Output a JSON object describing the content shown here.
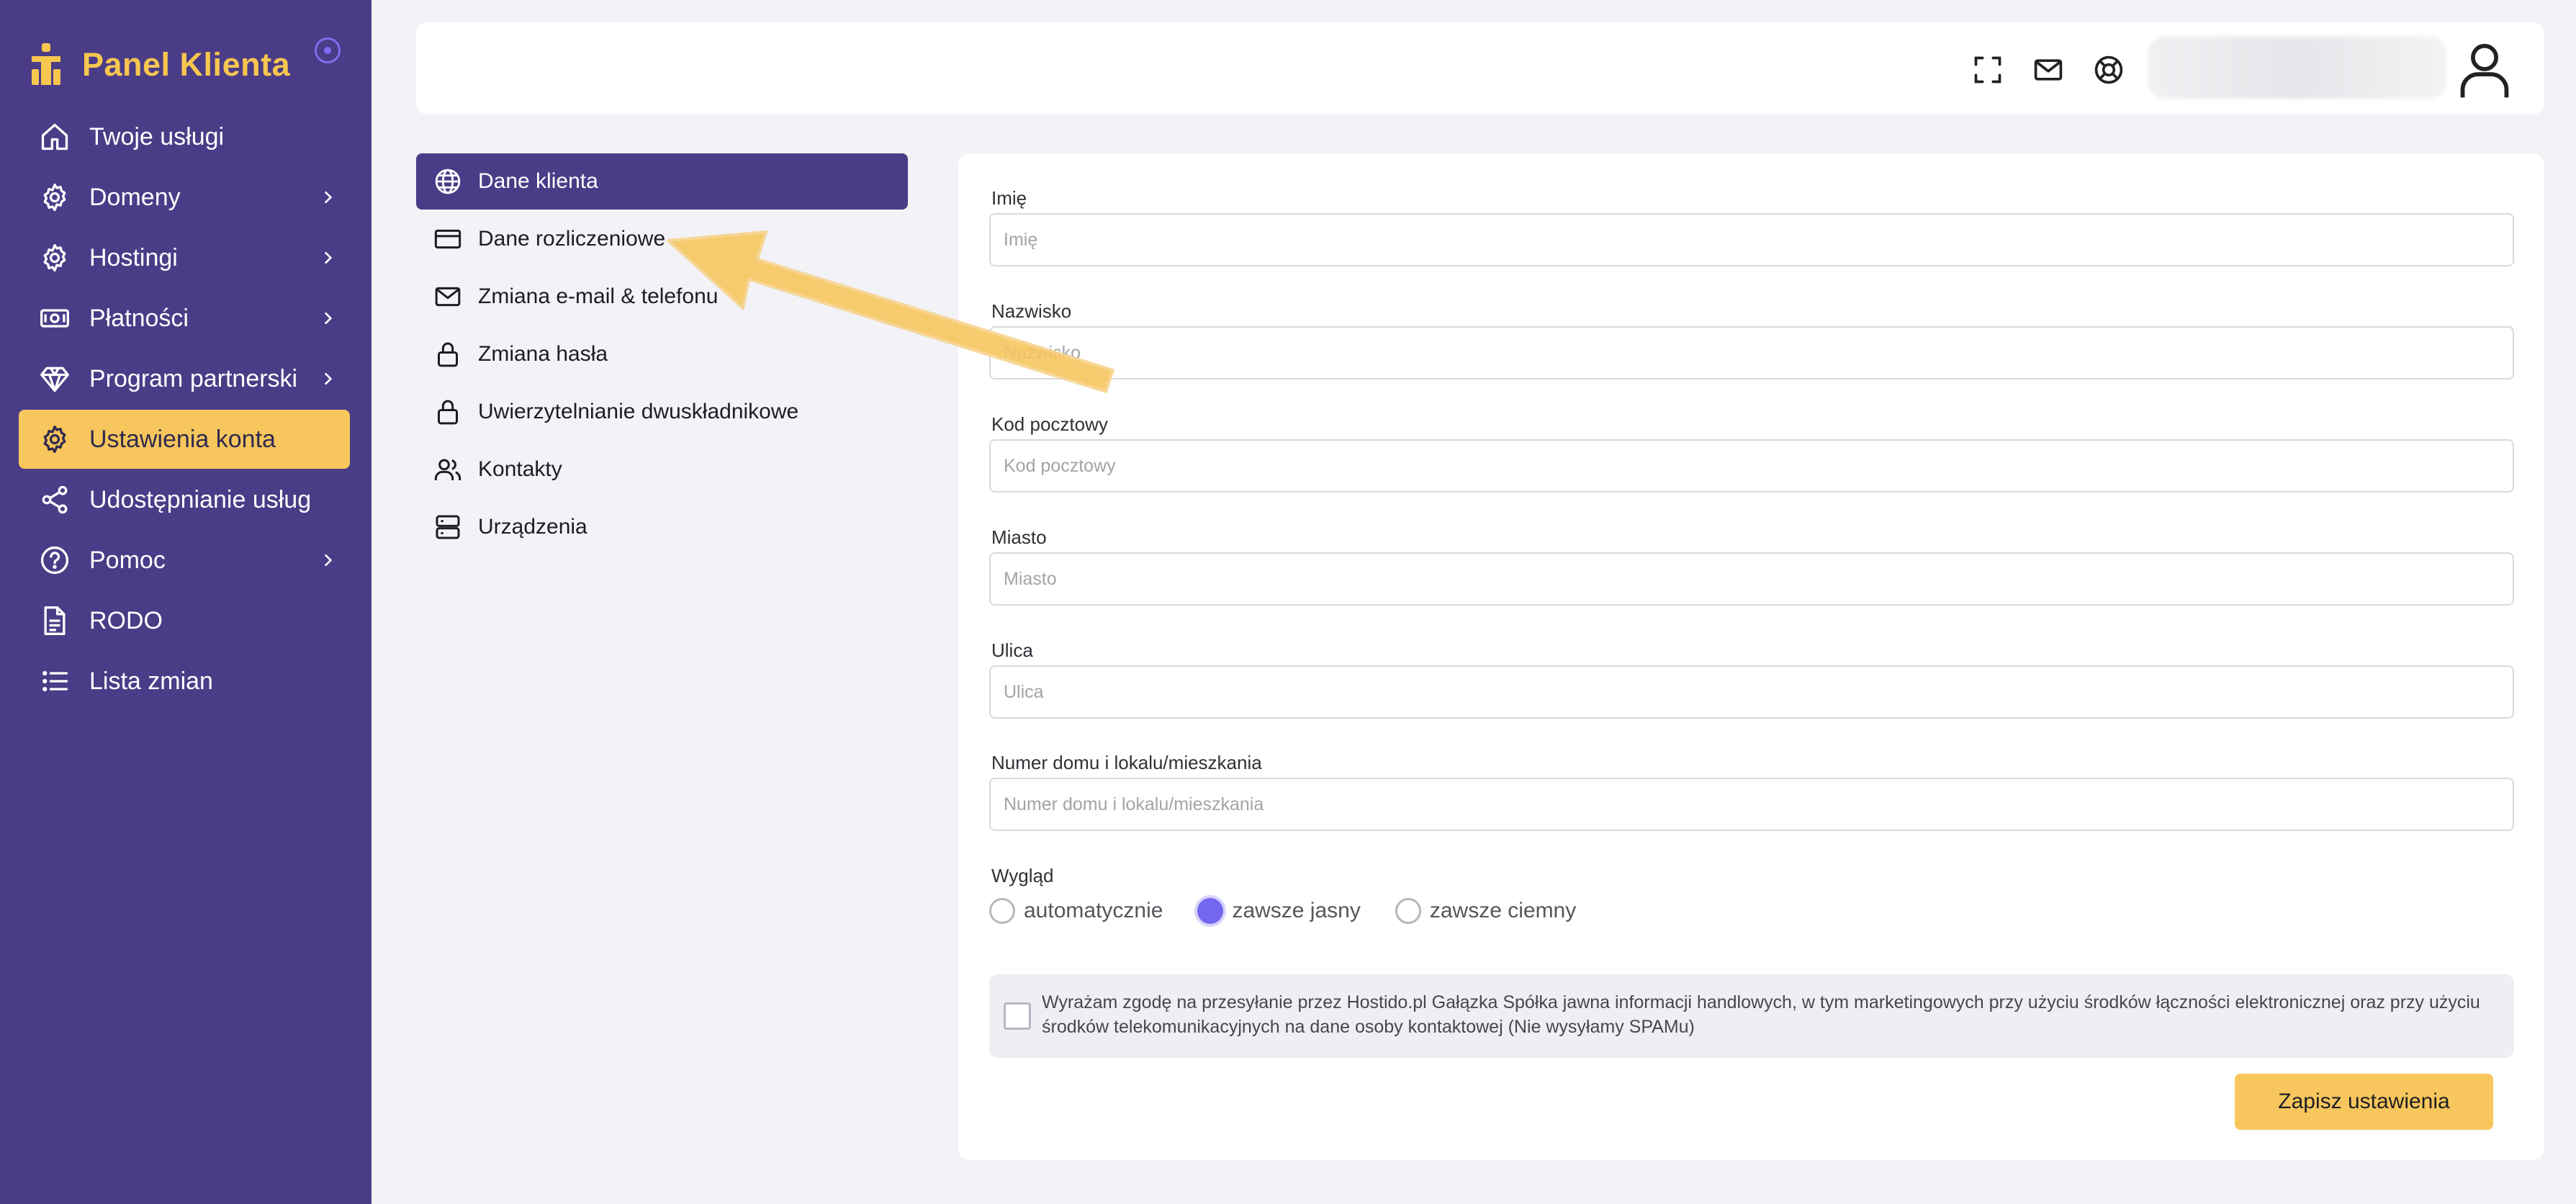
{
  "sidebar": {
    "brand": "Panel Klienta",
    "items": [
      {
        "label": "Twoje usługi",
        "icon": "home-icon",
        "chevron": false,
        "active": false
      },
      {
        "label": "Domeny",
        "icon": "gear-icon",
        "chevron": true,
        "active": false
      },
      {
        "label": "Hostingi",
        "icon": "gear-icon",
        "chevron": true,
        "active": false
      },
      {
        "label": "Płatności",
        "icon": "banknote-icon",
        "chevron": true,
        "active": false
      },
      {
        "label": "Program partnerski",
        "icon": "diamond-icon",
        "chevron": true,
        "active": false
      },
      {
        "label": "Ustawienia konta",
        "icon": "gear-icon",
        "chevron": false,
        "active": true
      },
      {
        "label": "Udostępnianie usług",
        "icon": "share-icon",
        "chevron": false,
        "active": false
      },
      {
        "label": "Pomoc",
        "icon": "help-circle-icon",
        "chevron": true,
        "active": false
      },
      {
        "label": "RODO",
        "icon": "document-icon",
        "chevron": false,
        "active": false
      },
      {
        "label": "Lista zmian",
        "icon": "list-icon",
        "chevron": false,
        "active": false
      }
    ]
  },
  "header": {
    "icons": [
      "fullscreen-icon",
      "mail-icon",
      "lifebuoy-icon",
      "user-icon"
    ]
  },
  "submenu": {
    "items": [
      {
        "label": "Dane klienta",
        "icon": "globe-icon",
        "active": true
      },
      {
        "label": "Dane rozliczeniowe",
        "icon": "credit-card-icon",
        "active": false
      },
      {
        "label": "Zmiana e-mail & telefonu",
        "icon": "mail-icon",
        "active": false
      },
      {
        "label": "Zmiana hasła",
        "icon": "lock-icon",
        "active": false
      },
      {
        "label": "Uwierzytelnianie dwuskładnikowe",
        "icon": "lock-icon",
        "active": false
      },
      {
        "label": "Kontakty",
        "icon": "users-icon",
        "active": false
      },
      {
        "label": "Urządzenia",
        "icon": "server-icon",
        "active": false
      }
    ]
  },
  "form": {
    "fields": [
      {
        "label": "Imię",
        "placeholder": "Imię",
        "value": ""
      },
      {
        "label": "Nazwisko",
        "placeholder": "Nazwisko",
        "value": ""
      },
      {
        "label": "Kod pocztowy",
        "placeholder": "Kod pocztowy",
        "value": ""
      },
      {
        "label": "Miasto",
        "placeholder": "Miasto",
        "value": ""
      },
      {
        "label": "Ulica",
        "placeholder": "Ulica",
        "value": ""
      },
      {
        "label": "Numer domu i lokalu/mieszkania",
        "placeholder": "Numer domu i lokalu/mieszkania",
        "value": ""
      }
    ],
    "appearance": {
      "label": "Wygląd",
      "options": [
        {
          "label": "automatycznie",
          "checked": false
        },
        {
          "label": "zawsze jasny",
          "checked": true
        },
        {
          "label": "zawsze ciemny",
          "checked": false
        }
      ]
    },
    "consent": {
      "text": "Wyrażam zgodę na przesyłanie przez Hostido.pl Gałązka Spółka jawna informacji handlowych, w tym marketingowych przy użyciu środków łączności elektronicznej oraz przy użyciu środków telekomunikacyjnych na dane osoby kontaktowej (Nie wysyłamy SPAMu)",
      "checked": false
    },
    "save_label": "Zapisz ustawienia"
  },
  "colors": {
    "sidebar_bg": "#4b3c87",
    "accent_yellow": "#f7c65c",
    "radio_purple": "#7366ef",
    "page_bg": "#f2f2f7"
  }
}
